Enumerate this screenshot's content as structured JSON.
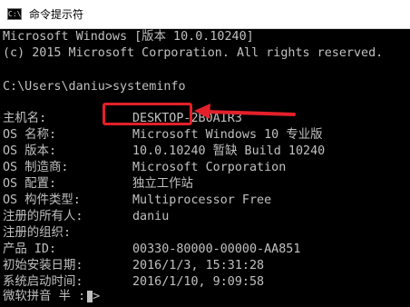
{
  "window": {
    "title": "命令提示符",
    "icon": "cmd-console-icon",
    "icon_glyph": "C:\\"
  },
  "banner": [
    "Microsoft Windows [版本 10.0.10240]",
    "(c) 2015 Microsoft Corporation. All rights reserved."
  ],
  "prompt": {
    "path": "C:\\Users\\daniu>",
    "command": "systeminfo"
  },
  "info": [
    {
      "label": "主机名:",
      "value": "DESKTOP-2B0AIR3"
    },
    {
      "label": "OS 名称:",
      "value": "Microsoft Windows 10 专业版"
    },
    {
      "label": "OS 版本:",
      "value": "10.0.10240 暂缺 Build 10240"
    },
    {
      "label": "OS 制造商:",
      "value": "Microsoft Corporation"
    },
    {
      "label": "OS 配置:",
      "value": "独立工作站"
    },
    {
      "label": "OS 构件类型:",
      "value": "Multiprocessor Free"
    },
    {
      "label": "注册的所有人:",
      "value": "daniu"
    },
    {
      "label": "注册的组织:",
      "value": ""
    },
    {
      "label": "产品 ID:",
      "value": "00330-80000-00000-AA851"
    },
    {
      "label": "初始安装日期:",
      "value": "2016/1/3, 15:31:28"
    },
    {
      "label": "系统启动时间:",
      "value": "2016/1/10, 9:09:58"
    }
  ],
  "ime_status": "微软拼音 半 :",
  "ime_tail": ">",
  "colors": {
    "console_bg": "#000000",
    "console_fg": "#c0c0c0",
    "annotation": "#e3202a"
  }
}
